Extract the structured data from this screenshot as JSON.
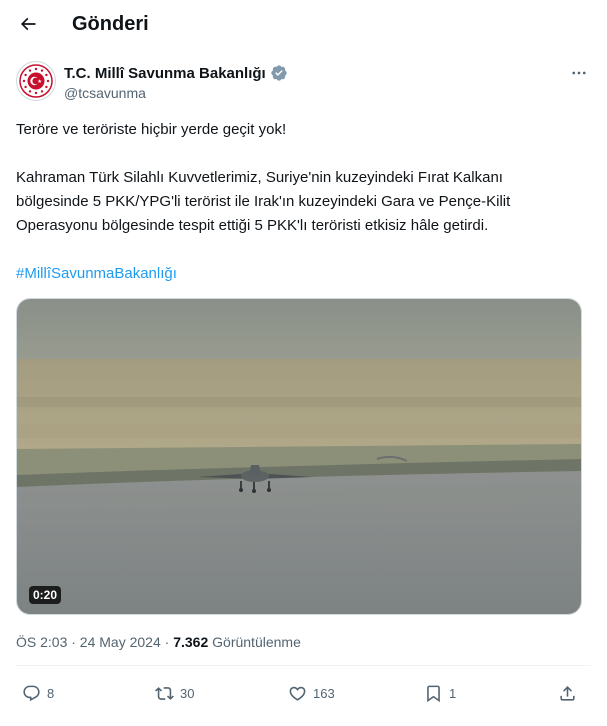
{
  "header": {
    "title": "Gönderi"
  },
  "author": {
    "name": "T.C. Millî Savunma Bakanlığı",
    "handle": "@tcsavunma"
  },
  "tweet": {
    "line1": "Teröre ve teröriste hiçbir yerde geçit yok!",
    "paragraph2_lines": [
      "Kahraman Türk Silahlı Kuvvetlerimiz, Suriye'nin kuzeyindeki Fırat Kalkanı",
      "bölgesinde 5 PKK/YPG'li terörist ile Irak'ın kuzeyindeki Gara ve Pençe-Kilit",
      "Operasyonu bölgesinde tespit ettiği 5 PKK'lı teröristi etkisiz hâle getirdi."
    ],
    "hashtag": "#MillîSavunmaBakanlığı"
  },
  "media": {
    "duration": "0:20"
  },
  "meta": {
    "time_date": "ÖS 2:03 · 24 May 2024 · ",
    "views_count": "7.362",
    "views_label": " Görüntülenme"
  },
  "actions": {
    "replies": "8",
    "reposts": "30",
    "likes": "163",
    "bookmarks": "1"
  },
  "icons": {
    "back": "arrow-left-icon",
    "verified": "verified-badge-icon",
    "more": "more-horizontal-icon",
    "reply": "reply-icon",
    "repost": "repost-icon",
    "like": "like-icon",
    "bookmark": "bookmark-icon",
    "share": "share-icon"
  },
  "colors": {
    "accent": "#1d9bf0",
    "text": "#0f1419",
    "secondary": "#536471",
    "verified": "#829aab"
  }
}
